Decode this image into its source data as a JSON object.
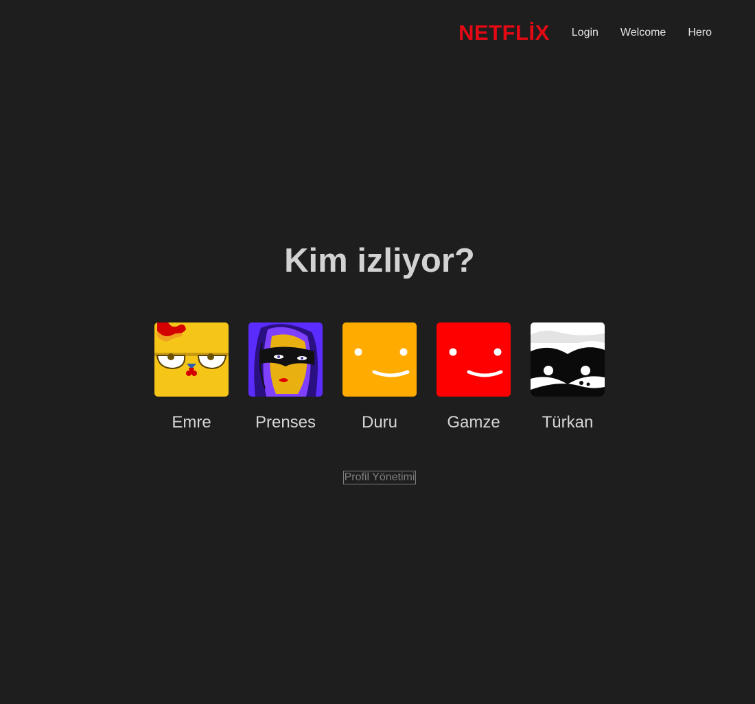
{
  "nav": {
    "logo": "NETFLİX",
    "links": [
      {
        "label": "Login"
      },
      {
        "label": "Welcome"
      },
      {
        "label": "Hero"
      }
    ]
  },
  "main": {
    "title": "Kim izliyor?",
    "profiles": [
      {
        "name": "Emre",
        "avatar_icon": "chicken-avatar-icon",
        "color": "#f5c518"
      },
      {
        "name": "Prenses",
        "avatar_icon": "masked-woman-avatar-icon",
        "color": "#5b2cff"
      },
      {
        "name": "Duru",
        "avatar_icon": "smiley-avatar-icon",
        "color": "#ffab00"
      },
      {
        "name": "Gamze",
        "avatar_icon": "smiley-avatar-icon",
        "color": "#ff0000"
      },
      {
        "name": "Türkan",
        "avatar_icon": "bandit-mask-avatar-icon",
        "color": "#ffffff"
      }
    ],
    "manage_label": "Profil Yönetimi"
  },
  "colors": {
    "background": "#1e1e1e",
    "brand": "#e50914"
  }
}
